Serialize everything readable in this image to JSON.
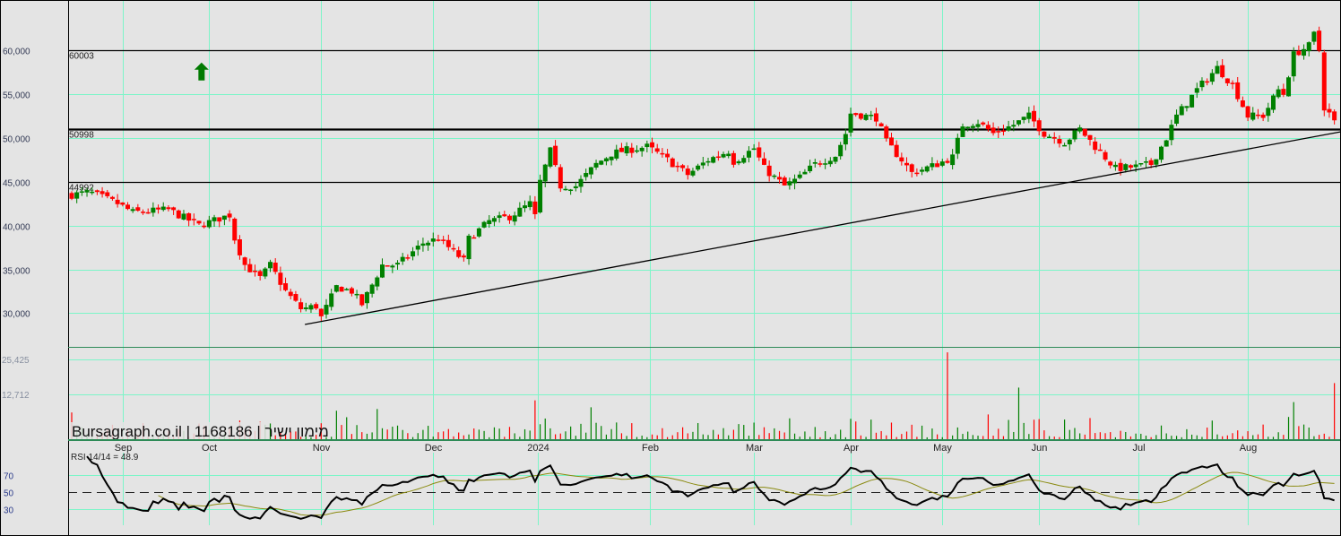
{
  "chart_data": {
    "type": "candlestick",
    "watermark": "Bursagraph.co.il | 1168186 | מימון ישיר",
    "price_axis": {
      "ticks": [
        30000,
        35000,
        40000,
        45000,
        50000,
        55000,
        60000
      ],
      "labels": [
        "30,000",
        "35,000",
        "40,000",
        "45,000",
        "50,000",
        "55,000",
        "60,000"
      ],
      "ylim": [
        26000,
        63000
      ]
    },
    "x_axis": {
      "total_days": 249,
      "month_ticks": [
        {
          "label": "Sep",
          "day": 10
        },
        {
          "label": "Oct",
          "day": 27
        },
        {
          "label": "Nov",
          "day": 49
        },
        {
          "label": "Dec",
          "day": 71
        },
        {
          "label": "2024",
          "day": 91.5
        },
        {
          "label": "Feb",
          "day": 113.5
        },
        {
          "label": "Mar",
          "day": 134
        },
        {
          "label": "Apr",
          "day": 153
        },
        {
          "label": "May",
          "day": 171
        },
        {
          "label": "Jun",
          "day": 190
        },
        {
          "label": "Jul",
          "day": 209.5
        },
        {
          "label": "Aug",
          "day": 231
        }
      ]
    },
    "levels": [
      {
        "value": 60003,
        "label": "60003",
        "weight": "normal"
      },
      {
        "value": 50998,
        "label": "50998",
        "weight": "bold"
      },
      {
        "value": 44992,
        "label": "44992",
        "weight": "normal"
      }
    ],
    "trendline": {
      "from": {
        "day": 45.8,
        "price": 28710
      },
      "to": {
        "day": 249.3,
        "price": 50700
      }
    },
    "signal": {
      "type": "up-arrow",
      "day": 25.5,
      "price": 58600
    },
    "close_keypoints": [
      [
        0,
        43500
      ],
      [
        3.5,
        43800
      ],
      [
        9,
        42500
      ],
      [
        12,
        41500
      ],
      [
        19,
        41800
      ],
      [
        25,
        40000
      ],
      [
        31,
        41200
      ],
      [
        32,
        38500
      ],
      [
        34,
        35500
      ],
      [
        37,
        34000
      ],
      [
        39,
        35500
      ],
      [
        42,
        32500
      ],
      [
        45,
        30500
      ],
      [
        48,
        30800
      ],
      [
        49,
        29500
      ],
      [
        52,
        33000
      ],
      [
        55,
        32500
      ],
      [
        57,
        31000
      ],
      [
        61,
        35500
      ],
      [
        64,
        35500
      ],
      [
        69,
        38000
      ],
      [
        72,
        38500
      ],
      [
        77,
        36000
      ],
      [
        78,
        38500
      ],
      [
        82,
        40500
      ],
      [
        86,
        41000
      ],
      [
        90,
        42500
      ],
      [
        91,
        41000
      ],
      [
        92,
        45000
      ],
      [
        94,
        48500
      ],
      [
        96,
        44500
      ],
      [
        99,
        44500
      ],
      [
        103,
        47000
      ],
      [
        106,
        48200
      ],
      [
        109,
        48600
      ],
      [
        113,
        49000
      ],
      [
        117,
        47500
      ],
      [
        121,
        45800
      ],
      [
        125,
        47500
      ],
      [
        129,
        48500
      ],
      [
        130,
        47300
      ],
      [
        134,
        48800
      ],
      [
        136,
        46500
      ],
      [
        140,
        44500
      ],
      [
        143,
        45500
      ],
      [
        146,
        47000
      ],
      [
        150,
        48000
      ],
      [
        152,
        50500
      ],
      [
        153,
        52800
      ],
      [
        158,
        52300
      ],
      [
        160,
        49500
      ],
      [
        163,
        47500
      ],
      [
        165,
        46000
      ],
      [
        170,
        47000
      ],
      [
        173,
        47800
      ],
      [
        175,
        51500
      ],
      [
        178,
        51800
      ],
      [
        181,
        50500
      ],
      [
        185,
        51500
      ],
      [
        188,
        52500
      ],
      [
        191,
        50500
      ],
      [
        195,
        49500
      ],
      [
        198,
        51000
      ],
      [
        201,
        49000
      ],
      [
        205,
        46500
      ],
      [
        209,
        46700
      ],
      [
        212,
        47000
      ],
      [
        215,
        50000
      ],
      [
        217,
        52500
      ],
      [
        221,
        55500
      ],
      [
        225,
        58000
      ],
      [
        228,
        56000
      ],
      [
        231,
        52500
      ],
      [
        234,
        52500
      ],
      [
        237,
        55500
      ],
      [
        238,
        55000
      ],
      [
        240,
        59500
      ],
      [
        243,
        60500
      ],
      [
        244,
        61800
      ],
      [
        245,
        60000
      ],
      [
        246,
        53500
      ],
      [
        248,
        52000
      ]
    ],
    "volume_axis": {
      "labels": [
        "25,425",
        "12,712"
      ],
      "values": [
        25425,
        12712
      ]
    },
    "volume_spikes": [
      [
        0,
        8000
      ],
      [
        172,
        25400
      ],
      [
        186,
        15200
      ],
      [
        91,
        11500
      ],
      [
        102,
        9500
      ],
      [
        240,
        11000
      ],
      [
        248,
        16500
      ],
      [
        52,
        8500
      ],
      [
        60,
        9000
      ]
    ],
    "rsi": {
      "label": "RSI 14/14 = 48.9",
      "period": 14,
      "ma_period": 14,
      "levels": [
        70,
        50,
        30
      ],
      "level_labels": [
        "70",
        "50",
        "30"
      ],
      "current": 48.9
    },
    "colors": {
      "up": "#008000",
      "down": "#ff0000",
      "grid": "#7cf5c8",
      "background": "#e4e4e4",
      "rsi": "#000000",
      "rsi_ma": "#8a8a10",
      "signal": "#007a00"
    }
  }
}
